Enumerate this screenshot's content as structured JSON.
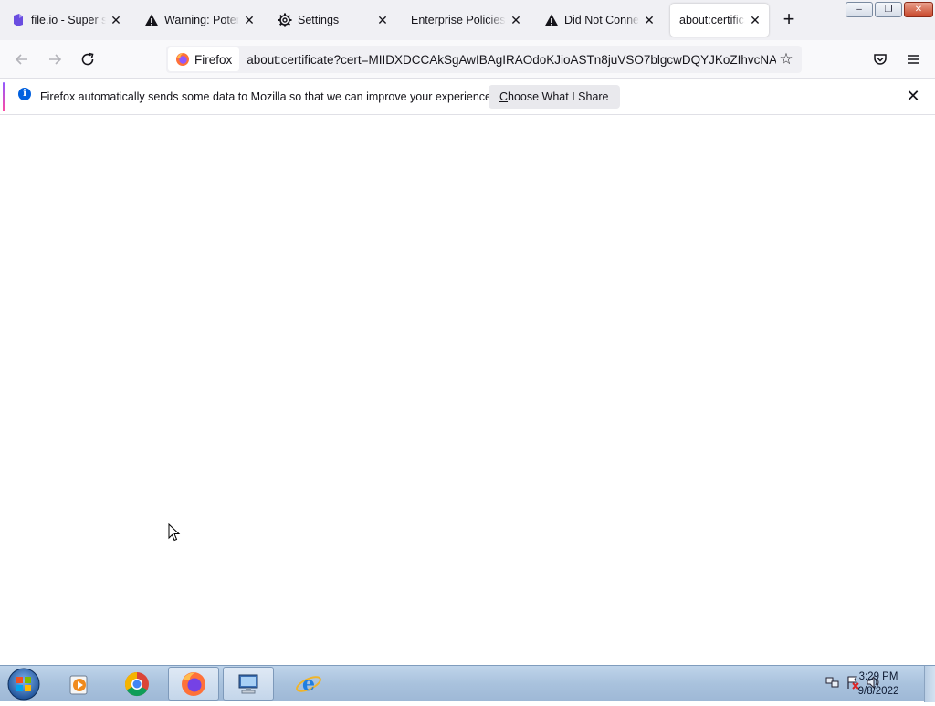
{
  "window_controls": {
    "minimize": "–",
    "maximize": "❐",
    "close": "✕"
  },
  "tabs": [
    {
      "label": "file.io - Super simple",
      "icon": "file-io-icon",
      "close": "✕"
    },
    {
      "label": "Warning: Potential Security",
      "icon": "warning-icon",
      "close": "✕"
    },
    {
      "label": "Settings",
      "icon": "gear-icon",
      "close": "✕"
    },
    {
      "label": "Enterprise Policies",
      "icon": "",
      "close": "✕"
    },
    {
      "label": "Did Not Connect",
      "icon": "warning-icon",
      "close": "✕"
    },
    {
      "label": "about:certificate",
      "icon": "",
      "close": "✕",
      "active": true
    }
  ],
  "new_tab": "+",
  "nav": {
    "back": "←",
    "forward": "→",
    "reload": "↻"
  },
  "urlbar": {
    "identity_label": "Firefox",
    "url": "about:certificate?cert=MIIDXDCCAkSgAwIBAgIRAOdoKJioASTn8juVSO7blgcwDQYJKoZIhvcNAQ",
    "bookmark_star": "☆"
  },
  "toolbar": {
    "pocket": "pocket-icon",
    "menu": "≡"
  },
  "infobar": {
    "message": "Firefox automatically sends some data to Mozilla so that we can improve your experience.",
    "button_label": "Choose What I Share",
    "button_accesskey": "C",
    "close": "✕",
    "info_glyph": "i"
  },
  "taskbar": {
    "items": [
      "windows-media-player-icon",
      "chrome-icon",
      "firefox-icon",
      "network-computer-icon",
      "internet-explorer-icon"
    ],
    "clock_time": "3:29 PM",
    "clock_date": "9/8/2022"
  },
  "colors": {
    "accent_blue": "#0060df",
    "tab_bg": "#f0f0f4",
    "taskbar": "#a9c2dd"
  }
}
